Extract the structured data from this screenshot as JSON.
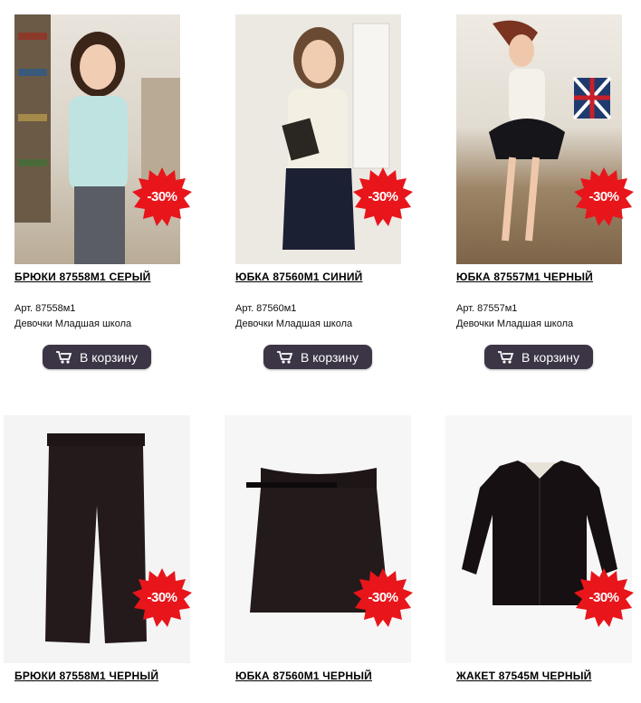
{
  "products": [
    {
      "title": "БРЮКИ 87558М1 СЕРЫЙ",
      "article": "Арт. 87558м1",
      "category": "Девочки Младшая школа",
      "discount": "-30%",
      "button": "В корзину"
    },
    {
      "title": "ЮБКА 87560М1 СИНИЙ",
      "article": "Арт. 87560м1",
      "category": "Девочки Младшая школа",
      "discount": "-30%",
      "button": "В корзину"
    },
    {
      "title": "ЮБКА 87557М1 ЧЕРНЫЙ",
      "article": "Арт. 87557м1",
      "category": "Девочки Младшая школа",
      "discount": "-30%",
      "button": "В корзину"
    },
    {
      "title": "БРЮКИ 87558М1 ЧЕРНЫЙ",
      "discount": "-30%"
    },
    {
      "title": "ЮБКА 87560М1 ЧЕРНЫЙ",
      "discount": "-30%"
    },
    {
      "title": "ЖАКЕТ 87545М ЧЕРНЫЙ",
      "discount": "-30%"
    }
  ],
  "colors": {
    "badge": "#e8151b",
    "button": "#3b3545"
  },
  "icons": {
    "cart": "shopping-cart-icon",
    "badge": "starburst-badge"
  }
}
